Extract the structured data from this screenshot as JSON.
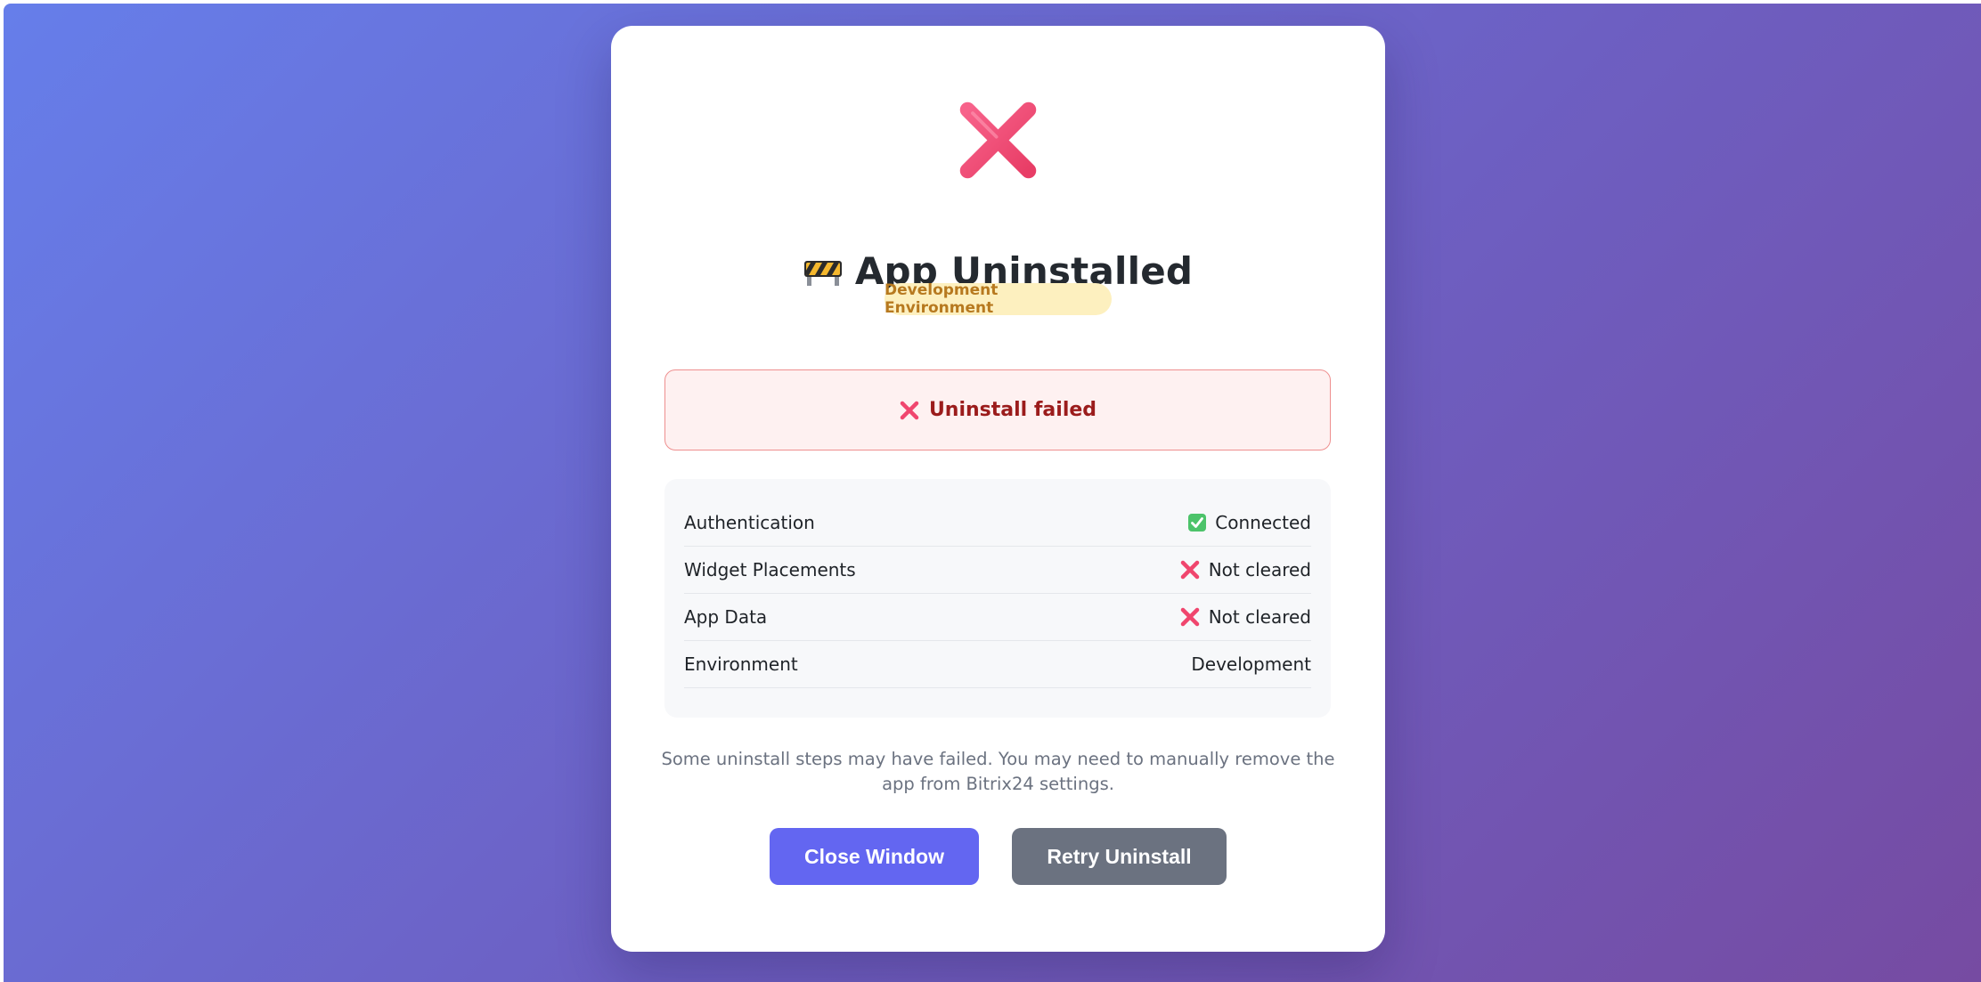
{
  "header": {
    "title": "App Uninstalled",
    "title_icon": "construction-barrier-icon",
    "status_icon": "cross-mark-icon",
    "environment_badge": "Development Environment"
  },
  "error_alert": {
    "icon": "cross-mark-icon",
    "message": "Uninstall failed"
  },
  "details": [
    {
      "label": "Authentication",
      "value": "Connected",
      "icon": "check-box-icon"
    },
    {
      "label": "Widget Placements",
      "value": "Not cleared",
      "icon": "cross-mark-icon"
    },
    {
      "label": "App Data",
      "value": "Not cleared",
      "icon": "cross-mark-icon"
    },
    {
      "label": "Environment",
      "value": "Development",
      "icon": ""
    }
  ],
  "note": "Some uninstall steps may have failed. You may need to manually remove the app from Bitrix24 settings.",
  "buttons": {
    "close": "Close Window",
    "retry": "Retry Uninstall"
  },
  "colors": {
    "gradient_start": "#667eea",
    "gradient_end": "#764ba2",
    "error_red": "#f0466e",
    "badge_bg": "#fdf0bf",
    "badge_text": "#b7791f",
    "primary_button": "#6366f1",
    "secondary_button": "#6b7280"
  }
}
